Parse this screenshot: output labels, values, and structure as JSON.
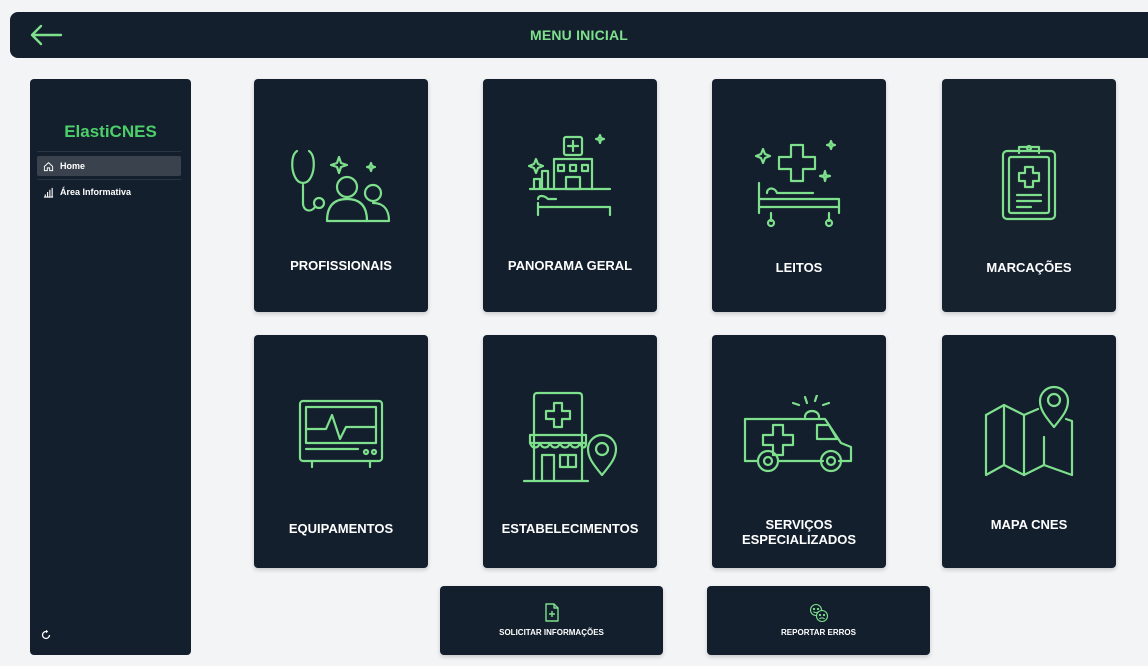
{
  "header": {
    "title": "MENU INICIAL",
    "back_icon": "arrow-left-icon"
  },
  "sidebar": {
    "brand": "ElastiCNES",
    "items": [
      {
        "label": "Home",
        "icon": "home-icon",
        "active": true
      },
      {
        "label": "Área Informativa",
        "icon": "bar-chart-icon",
        "active": false
      }
    ],
    "footer_icon": "refresh-icon"
  },
  "cards": [
    {
      "label": "PROFISSIONAIS",
      "icon": "doctor-stethoscope-icon"
    },
    {
      "label": "PANORAMA GERAL",
      "icon": "hospital-overview-icon"
    },
    {
      "label": "LEITOS",
      "icon": "hospital-bed-icon"
    },
    {
      "label": "MARCAÇÕES",
      "icon": "medical-clipboard-icon"
    },
    {
      "label": "EQUIPAMENTOS",
      "icon": "heart-monitor-icon"
    },
    {
      "label": "ESTABELECIMENTOS",
      "icon": "health-facility-location-icon"
    },
    {
      "label": "SERVIÇOS ESPECIALIZADOS",
      "icon": "ambulance-icon"
    },
    {
      "label": "MAPA CNES",
      "icon": "map-pin-icon"
    }
  ],
  "actions": [
    {
      "label": "SOLICITAR INFORMAÇÕES",
      "icon": "file-add-icon"
    },
    {
      "label": "REPORTAR ERROS",
      "icon": "smiley-faces-icon"
    }
  ],
  "colors": {
    "accent": "#7ee08c",
    "brand": "#4ccf6a",
    "panel": "#131f2d",
    "background": "#f3f4f6"
  }
}
